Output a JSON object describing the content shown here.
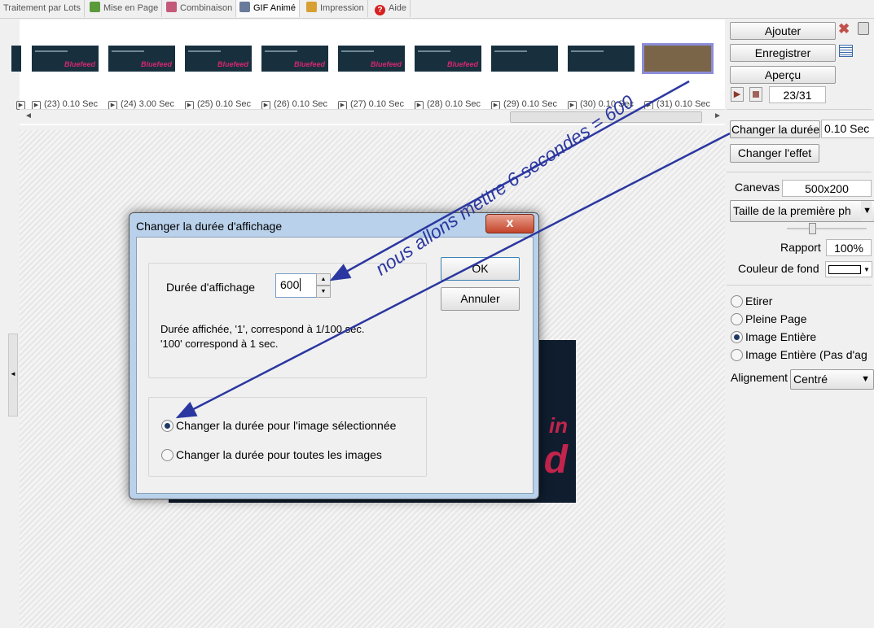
{
  "tabs": [
    {
      "label": "Traitement par Lots",
      "icon": "batch-icon"
    },
    {
      "label": "Mise en Page",
      "icon": "layout-icon"
    },
    {
      "label": "Combinaison",
      "icon": "combine-icon"
    },
    {
      "label": "GIF Animé",
      "icon": "gif-icon"
    },
    {
      "label": "Impression",
      "icon": "print-icon"
    },
    {
      "label": "Aide",
      "icon": "help-icon"
    }
  ],
  "thumbnails": {
    "frames": [
      {
        "label": "(23) 0.10 Sec"
      },
      {
        "label": "(24) 3.00 Sec"
      },
      {
        "label": "(25) 0.10 Sec"
      },
      {
        "label": "(26) 0.10 Sec"
      },
      {
        "label": "(27) 0.10 Sec"
      },
      {
        "label": "(28) 0.10 Sec"
      },
      {
        "label": "(29) 0.10 Sec"
      },
      {
        "label": "(30) 0.10 Sec"
      },
      {
        "label": "(31) 0.10 Sec"
      }
    ],
    "thumb_text": "Bluefeed"
  },
  "preview": {
    "text_1": "in",
    "text_2": "d"
  },
  "right_panel": {
    "add_label": "Ajouter",
    "save_label": "Enregistrer",
    "preview_label": "Aperçu",
    "frame_counter": "23/31",
    "change_duration_label": "Changer la durée",
    "duration_value": "0.10 Sec",
    "change_effect_label": "Changer l'effet",
    "canvas_label": "Canevas",
    "canvas_value": "500x200",
    "size_select": "Taille de la première ph",
    "ratio_label": "Rapport",
    "ratio_value": "100%",
    "bg_color_label": "Couleur de fond",
    "radios": [
      {
        "label": "Etirer",
        "selected": false
      },
      {
        "label": "Pleine Page",
        "selected": false
      },
      {
        "label": "Image Entière",
        "selected": true
      },
      {
        "label": "Image Entière (Pas d'ag",
        "selected": false
      }
    ],
    "align_label": "Alignement",
    "align_value": "Centré"
  },
  "dialog": {
    "title": "Changer la durée d'affichage",
    "close_label": "x",
    "duration_label": "Durée d'affichage",
    "duration_value": "600",
    "hint_line1": "Durée affichée, '1', correspond à 1/100 sec.",
    "hint_line2": "'100' correspond à 1 sec.",
    "ok_label": "OK",
    "cancel_label": "Annuler",
    "option_selected": "Changer la durée pour l'image sélectionnée",
    "option_all": "Changer la durée pour toutes les images"
  },
  "annotation": {
    "text": "nous allons mettre 6 secondes = 600",
    "color": "#2b37a0"
  }
}
